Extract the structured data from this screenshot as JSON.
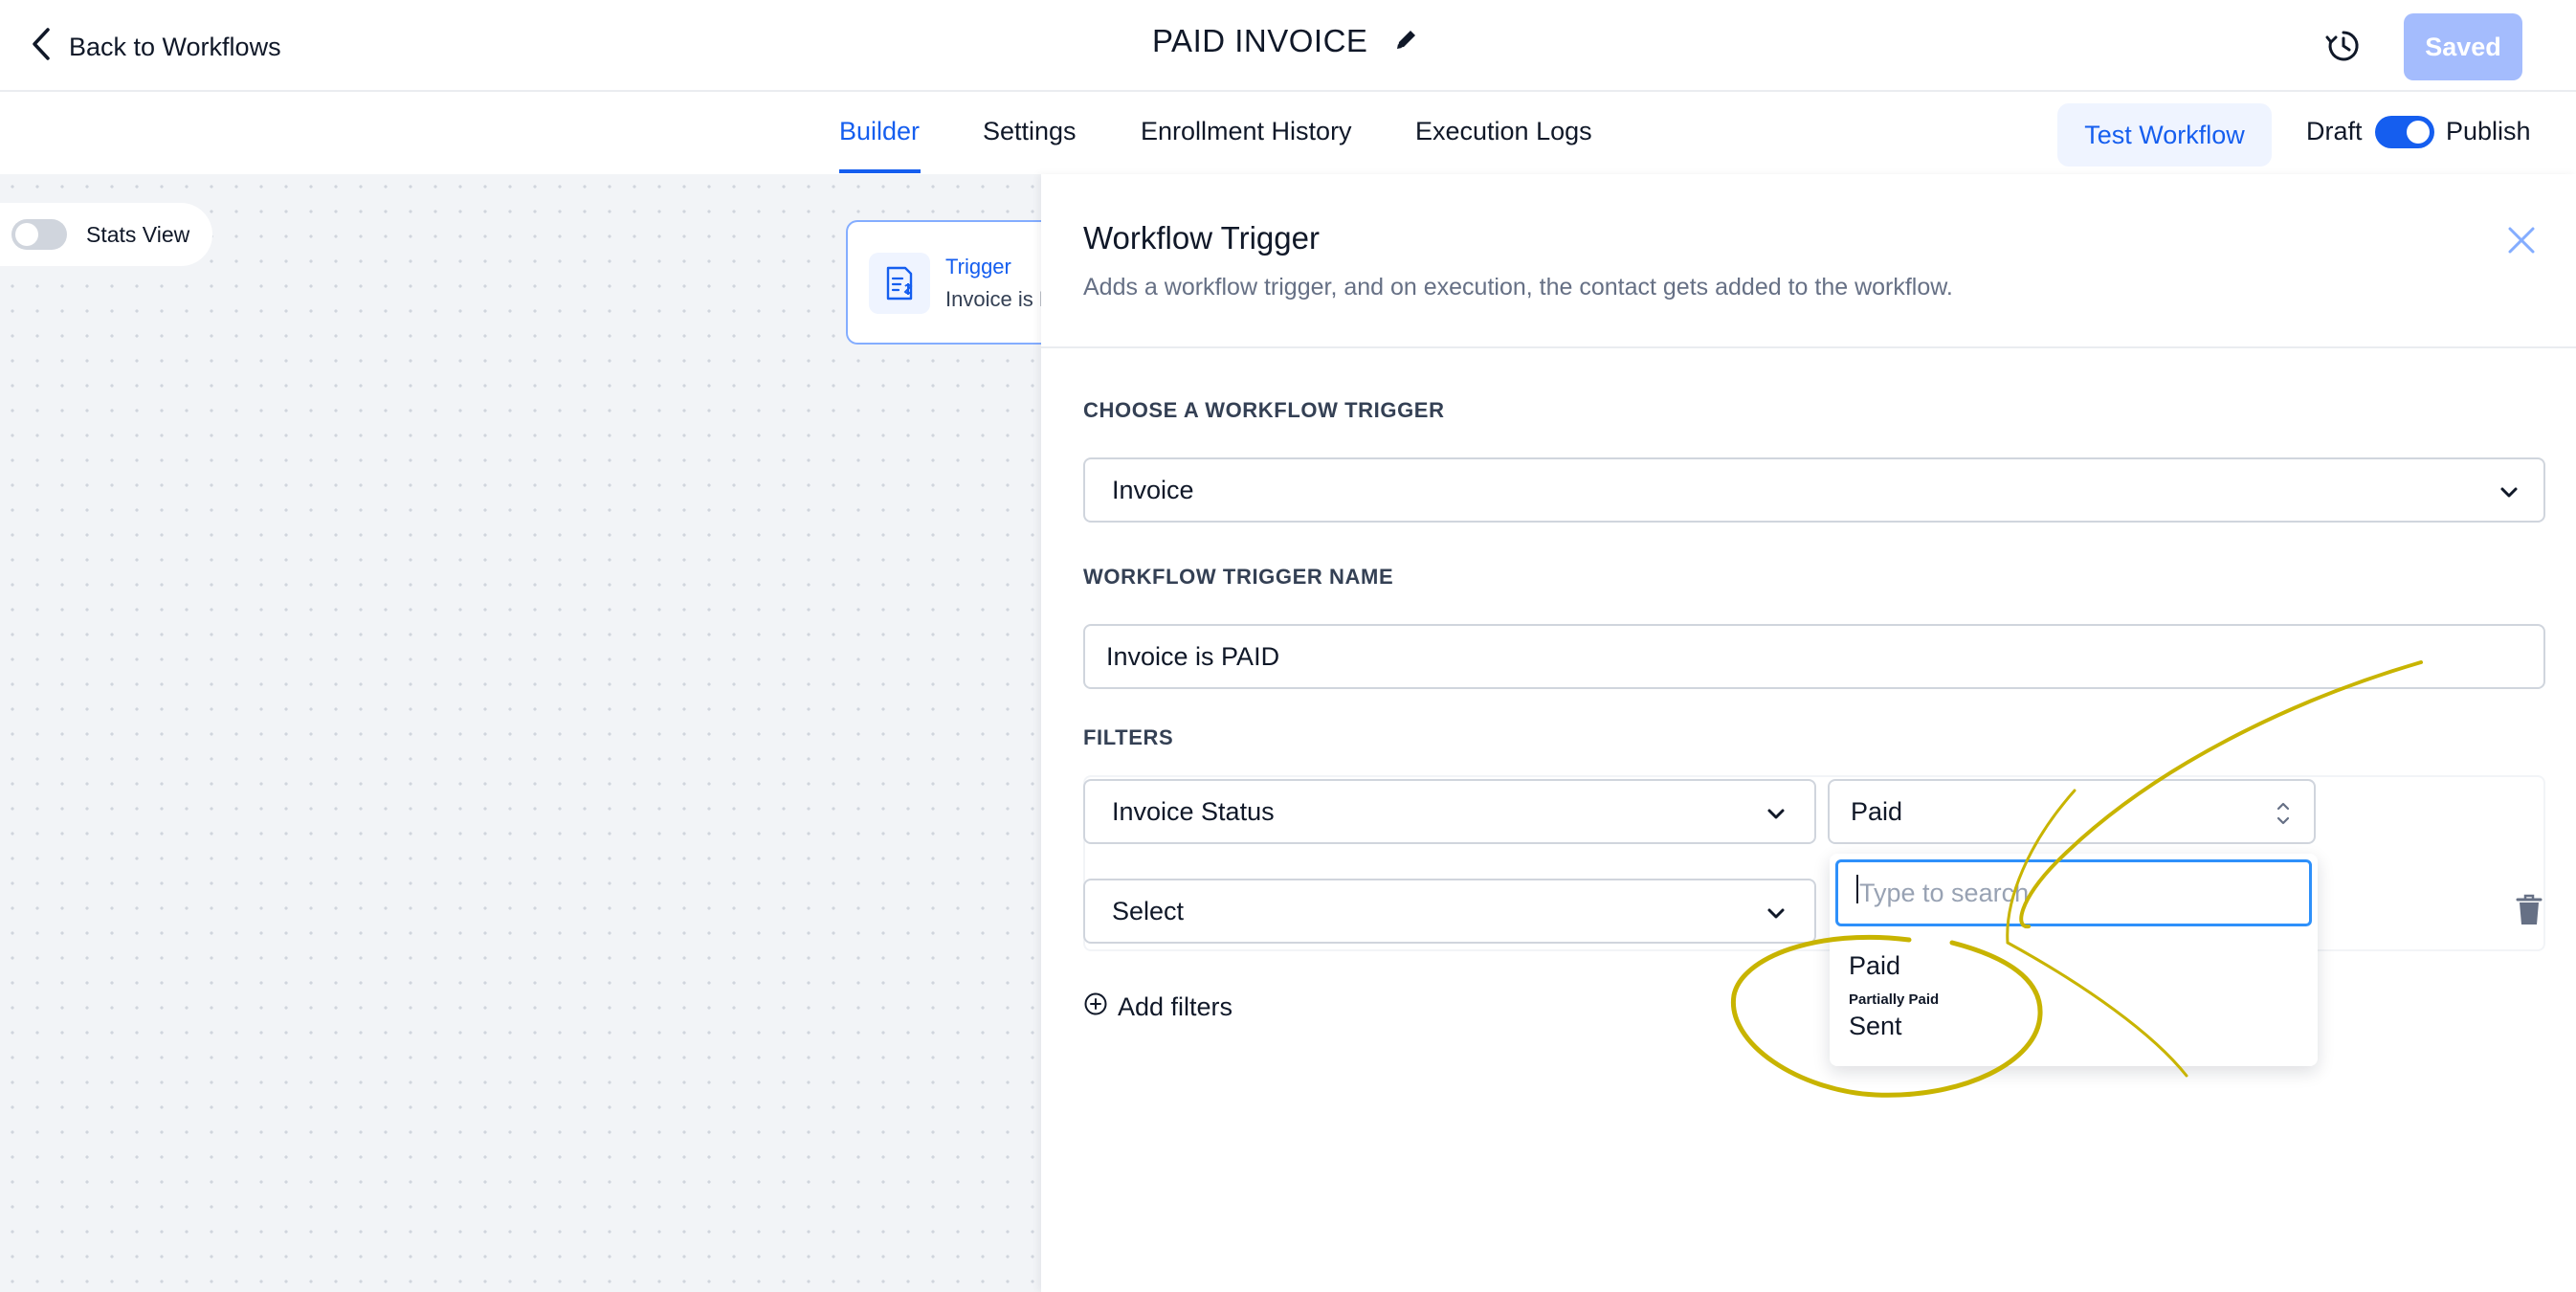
{
  "header": {
    "back_label": "Back to Workflows",
    "title": "PAID INVOICE",
    "saved_label": "Saved"
  },
  "tabs": {
    "items": [
      "Builder",
      "Settings",
      "Enrollment History",
      "Execution Logs"
    ],
    "active": "Builder",
    "test_label": "Test Workflow",
    "draft_label": "Draft",
    "publish_label": "Publish",
    "publish_toggle_on": true
  },
  "canvas": {
    "stats_label": "Stats View",
    "stats_on": false,
    "node": {
      "title": "Trigger",
      "subtitle": "Invoice is PAID"
    }
  },
  "panel": {
    "title": "Workflow Trigger",
    "description": "Adds a workflow trigger, and on execution, the contact gets added to the workflow.",
    "choose_label": "CHOOSE A WORKFLOW TRIGGER",
    "trigger_value": "Invoice",
    "name_label": "WORKFLOW TRIGGER NAME",
    "name_value": "Invoice is PAID",
    "filters_label": "FILTERS",
    "filter1_field": "Invoice Status",
    "filter1_value": "Paid",
    "filter2_field": "Select",
    "add_filters_label": "Add filters",
    "dropdown": {
      "placeholder": "Type to search",
      "options": [
        "Paid",
        "Partially Paid",
        "Sent"
      ]
    }
  },
  "colors": {
    "accent": "#155eef",
    "saved_disabled": "#a4bcfd",
    "annotation": "#c8b400"
  },
  "icons": [
    "chevron-left-icon",
    "pencil-icon",
    "history-icon",
    "invoice-icon",
    "close-icon",
    "chevron-down-icon",
    "updown-icon",
    "trash-icon",
    "plus-circle-icon"
  ]
}
